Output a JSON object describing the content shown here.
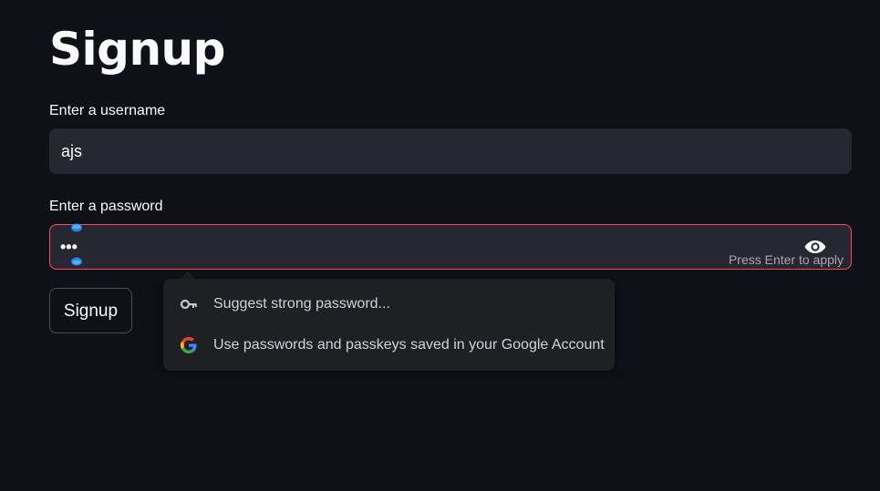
{
  "page": {
    "title": "Signup"
  },
  "username": {
    "label": "Enter a username",
    "value": "ajs"
  },
  "password": {
    "label": "Enter a password",
    "masked_value": "•••",
    "hint": "Press Enter to apply",
    "toggle_icon": "eye-icon"
  },
  "signup_button": {
    "label": "Signup"
  },
  "autofill_popup": {
    "items": [
      {
        "icon": "key-icon",
        "label": "Suggest strong password..."
      },
      {
        "icon": "google-icon",
        "label": "Use passwords and passkeys saved in your Google Account"
      }
    ]
  },
  "colors": {
    "background": "#0e1117",
    "input_background": "#262730",
    "focus_border": "#ff4b4b",
    "popup_background": "#1f2023"
  }
}
